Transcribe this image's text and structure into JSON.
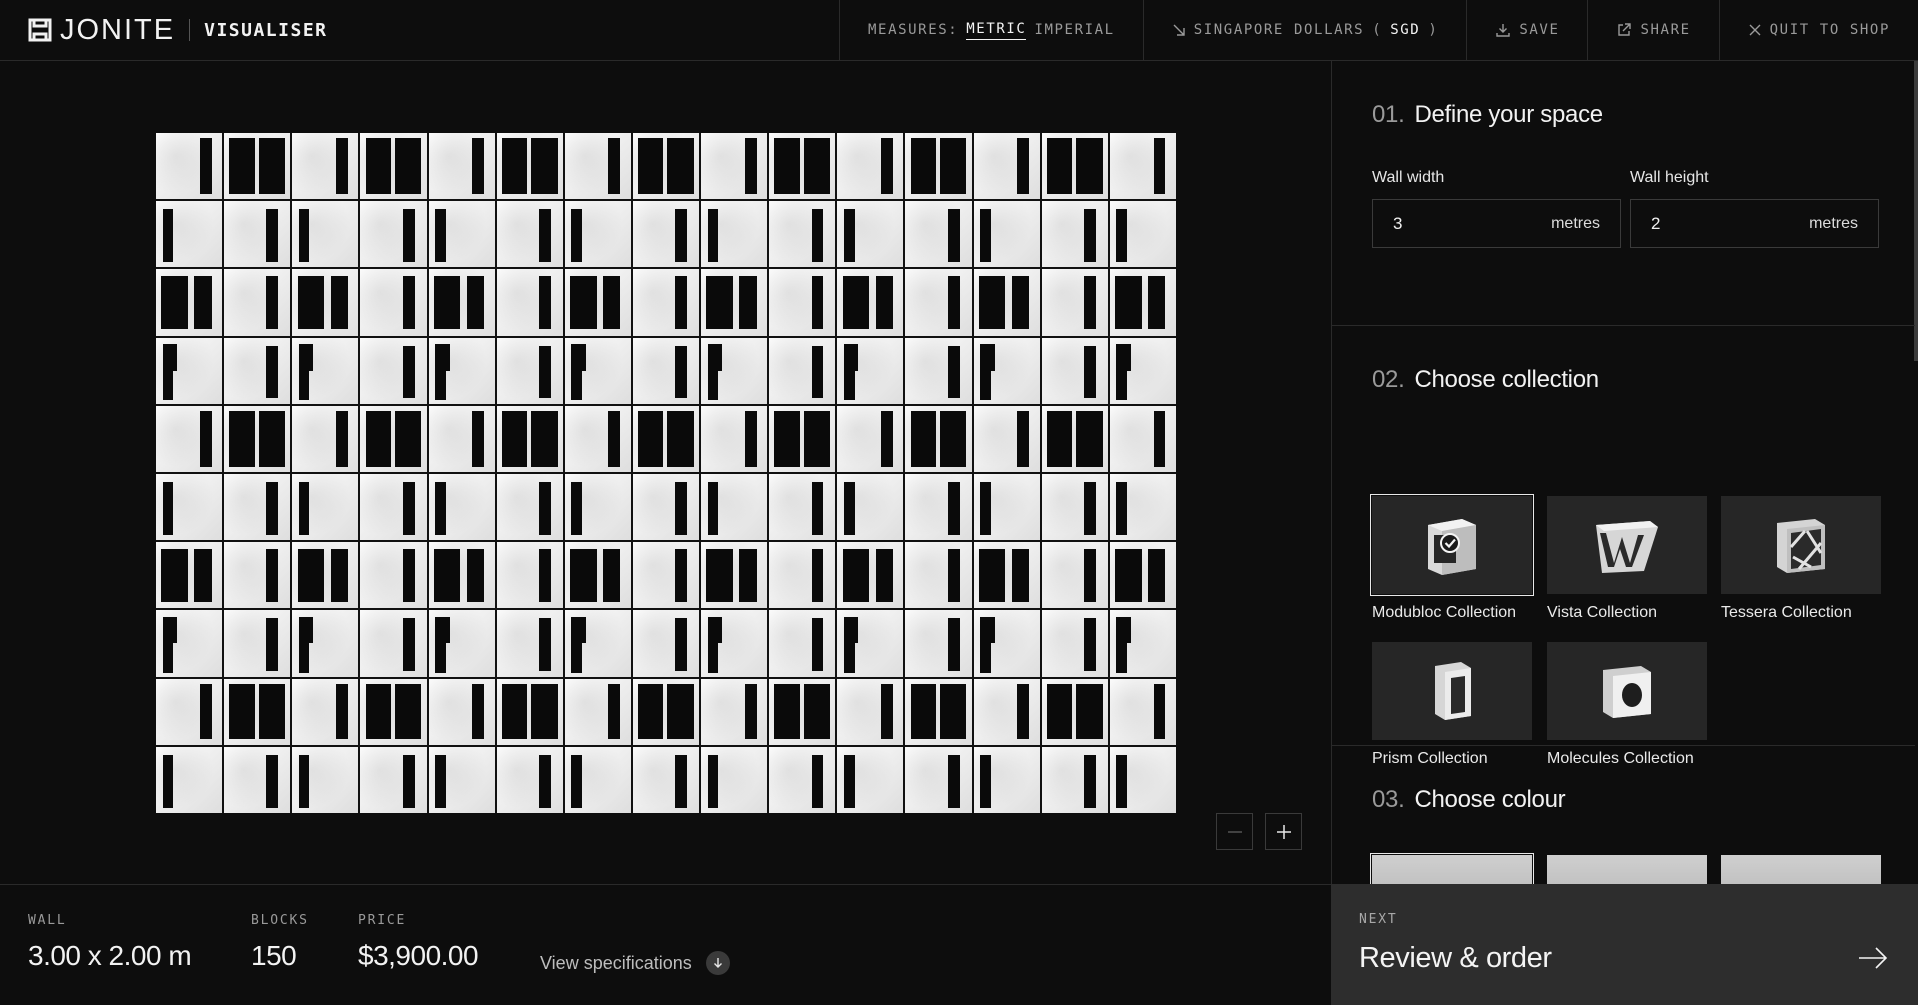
{
  "header": {
    "brand": "JONITE",
    "subtitle": "VISUALISER",
    "measures_label": "MEASURES:",
    "measures_options": [
      "METRIC",
      "IMPERIAL"
    ],
    "measures_selected": "METRIC",
    "currency_label": "SINGAPORE DOLLARS",
    "currency_code": "SGD",
    "save_label": "SAVE",
    "share_label": "SHARE",
    "quit_label": "QUIT TO SHOP"
  },
  "wall": {
    "columns": 15,
    "rows": 10,
    "block_color": "#ffffff",
    "slot_color": "#0a0a0a"
  },
  "zoom": {
    "minus_icon": "minus-icon",
    "plus_icon": "plus-icon"
  },
  "panel": {
    "section1": {
      "number": "01.",
      "title": "Define your space",
      "width_label": "Wall width",
      "width_value": "3",
      "width_unit": "metres",
      "height_label": "Wall height",
      "height_value": "2",
      "height_unit": "metres"
    },
    "section2": {
      "number": "02.",
      "title": "Choose collection",
      "collections": [
        {
          "label": "Modubloc Collection",
          "selected": true,
          "icon": "modubloc-block-icon"
        },
        {
          "label": "Vista Collection",
          "selected": false,
          "icon": "vista-block-icon"
        },
        {
          "label": "Tessera Collection",
          "selected": false,
          "icon": "tessera-block-icon"
        },
        {
          "label": "Prism Collection",
          "selected": false,
          "icon": "prism-block-icon"
        },
        {
          "label": "Molecules Collection",
          "selected": false,
          "icon": "molecules-block-icon"
        }
      ]
    },
    "section3": {
      "number": "03.",
      "title": "Choose colour"
    }
  },
  "footer": {
    "wall_label": "WALL",
    "wall_value": "3.00 x 2.00 m",
    "blocks_label": "BLOCKS",
    "blocks_value": "150",
    "price_label": "PRICE",
    "price_value": "$3,900.00",
    "specs_label": "View specifications"
  },
  "next": {
    "label": "NEXT",
    "title": "Review & order"
  }
}
